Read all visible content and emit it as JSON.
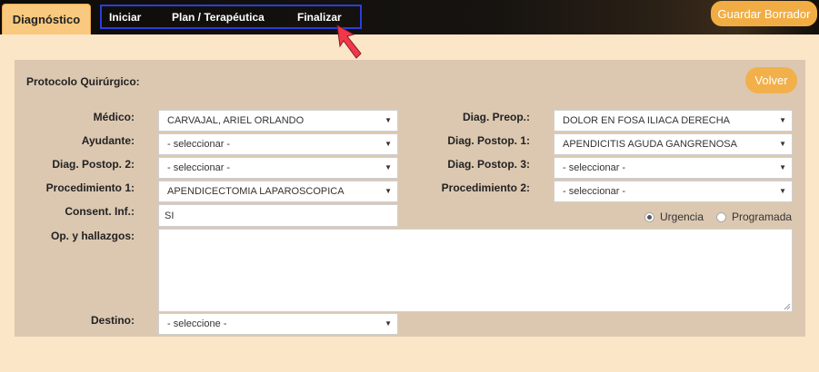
{
  "tabs": {
    "active": "Diagnóstico",
    "items": [
      "Iniciar",
      "Plan / Terapéutica",
      "Finalizar"
    ]
  },
  "toolbar": {
    "save_draft": "Guardar Borrador"
  },
  "form": {
    "title": "Protocolo Quirúrgico:",
    "back": "Volver",
    "medico": {
      "label": "Médico:",
      "value": "CARVAJAL, ARIEL ORLANDO"
    },
    "diag_preop": {
      "label": "Diag. Preop.:",
      "value": "DOLOR EN FOSA ILIACA DERECHA"
    },
    "ayudante": {
      "label": "Ayudante:",
      "value": "- seleccionar -"
    },
    "diag_postop1": {
      "label": "Diag. Postop. 1:",
      "value": "APENDICITIS AGUDA GANGRENOSA"
    },
    "diag_postop2": {
      "label": "Diag. Postop. 2:",
      "value": "- seleccionar -"
    },
    "diag_postop3": {
      "label": "Diag. Postop. 3:",
      "value": "- seleccionar -"
    },
    "procedimiento1": {
      "label": "Procedimiento 1:",
      "value": "APENDICECTOMIA LAPAROSCOPICA"
    },
    "procedimiento2": {
      "label": "Procedimiento 2:",
      "value": "- seleccionar -"
    },
    "consent": {
      "label": "Consent. Inf.:",
      "value": "SI"
    },
    "urgencia": {
      "label": "Urgencia",
      "checked": true
    },
    "programada": {
      "label": "Programada",
      "checked": false
    },
    "hallazgos": {
      "label": "Op. y hallazgos:",
      "value": ""
    },
    "destino": {
      "label": "Destino:",
      "value": "- seleccione -"
    }
  },
  "colors": {
    "accent": "#f1ad43",
    "panel": "#dcc8b1",
    "page": "#fbe6c8",
    "tab_highlight": "#2b3dde",
    "pointer": "#f0384a"
  },
  "icons": {
    "dropdown": "chevron-down-icon",
    "pointer": "cursor-arrow-icon"
  }
}
